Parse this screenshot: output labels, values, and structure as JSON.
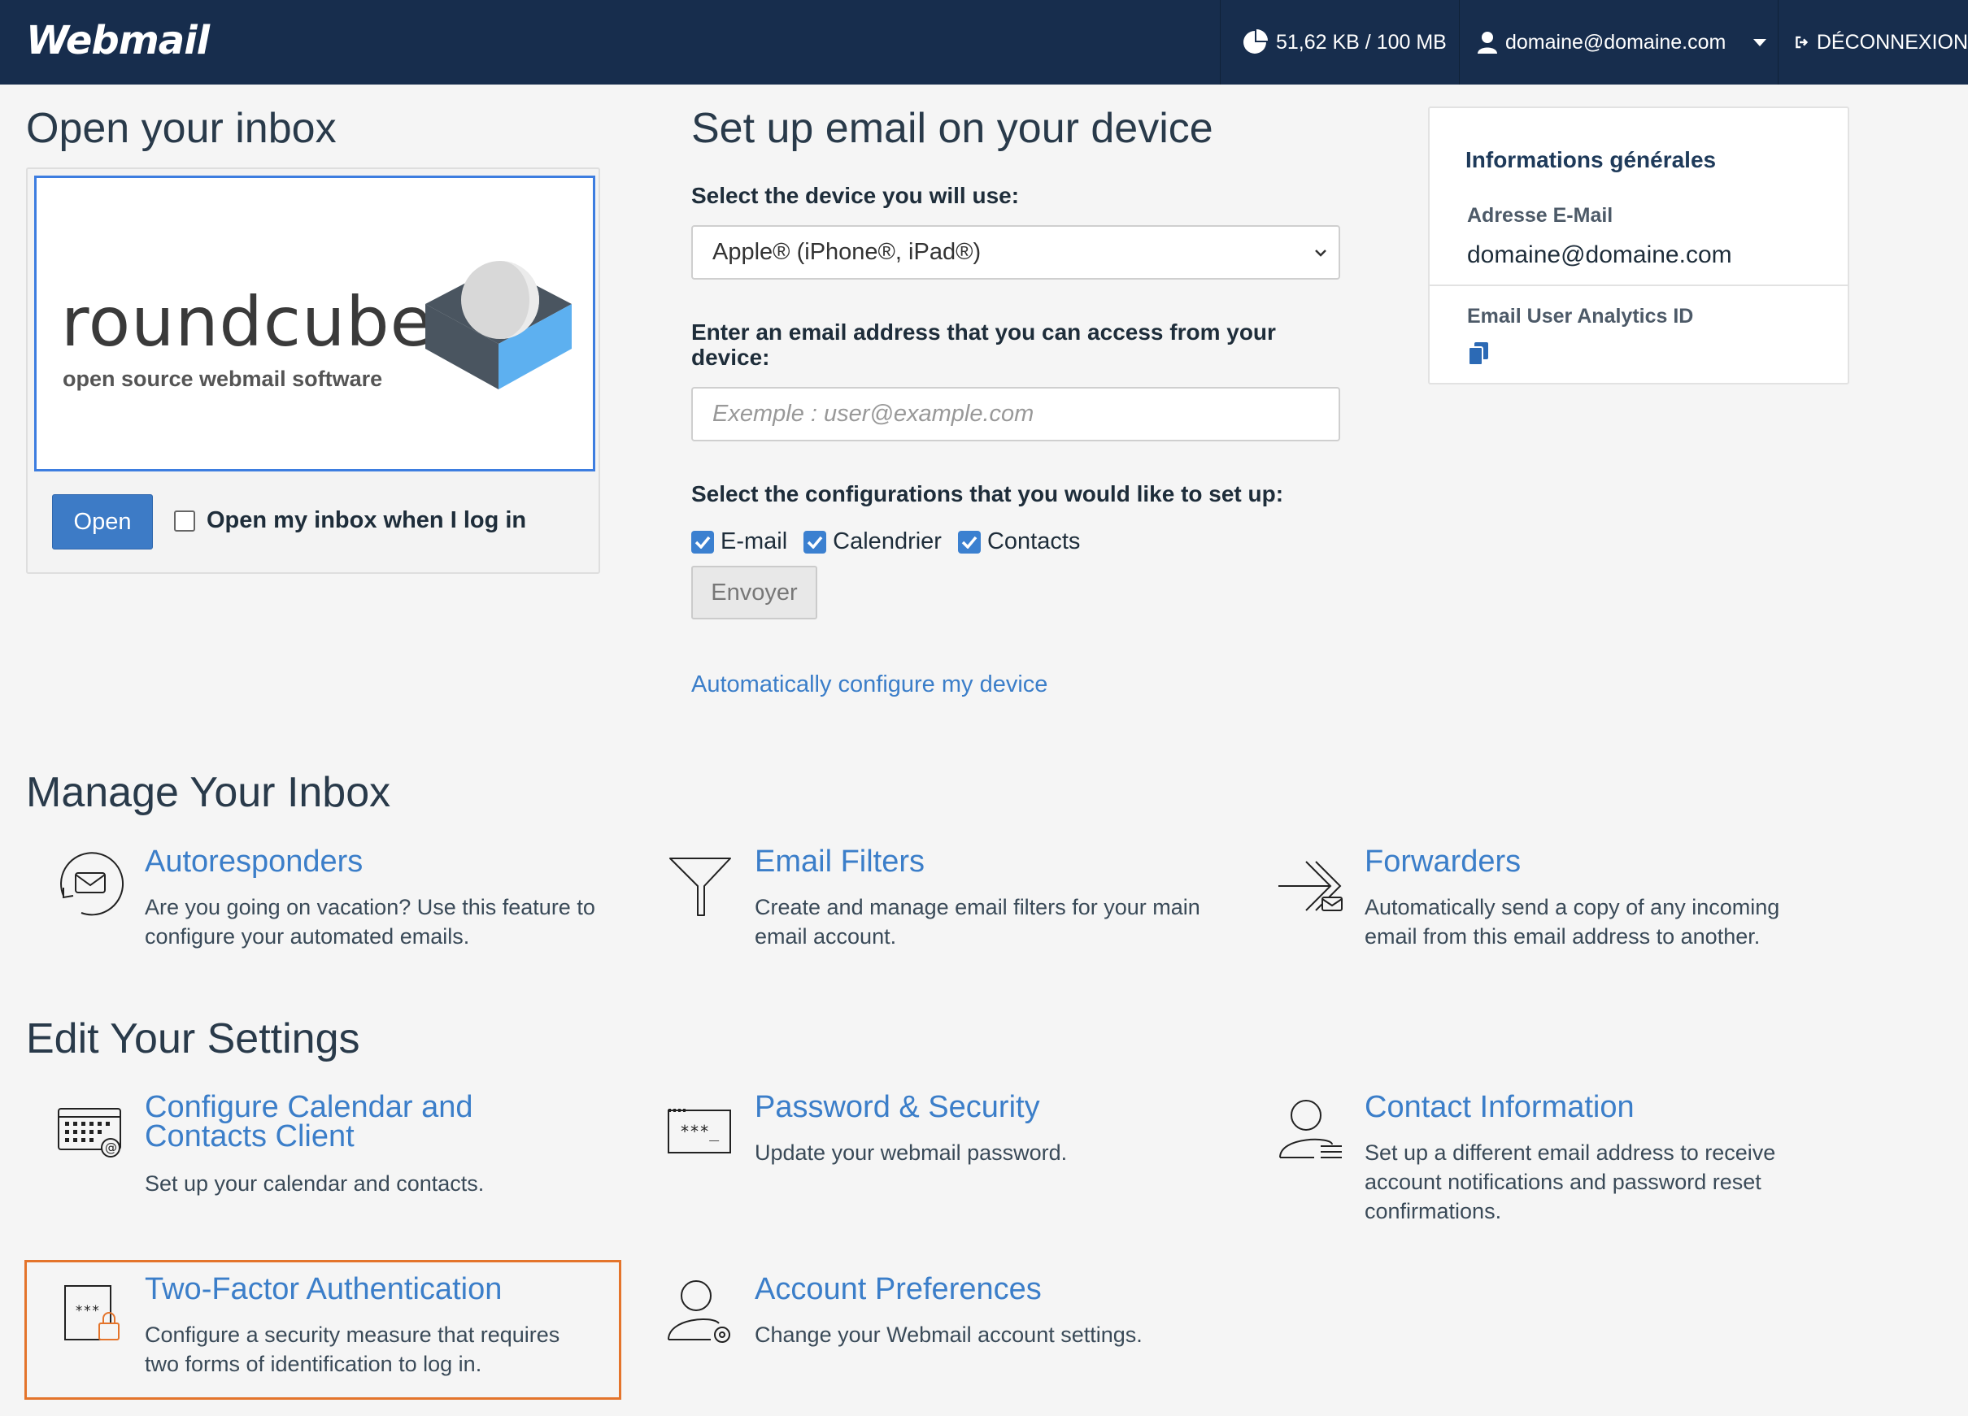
{
  "topbar": {
    "brand": "Webmail",
    "disk_usage": "51,62 KB / 100 MB",
    "user": "domaine@domaine.com",
    "logout": "DÉCONNEXION"
  },
  "inbox": {
    "heading": "Open your inbox",
    "logo_word": "roundcube",
    "logo_sub": "open source webmail software",
    "open_button": "Open",
    "open_on_login_label": "Open my inbox when I log in"
  },
  "device": {
    "heading": "Set up email on your device",
    "select_label": "Select the device you will use:",
    "select_value": "Apple® (iPhone®, iPad®)",
    "email_label": "Enter an email address that you can access from your device:",
    "email_placeholder": "Exemple : user@example.com",
    "config_label": "Select the configurations that you would like to set up:",
    "options": [
      "E-mail",
      "Calendrier",
      "Contacts"
    ],
    "send_button": "Envoyer",
    "auto_link": "Automatically configure my device"
  },
  "info": {
    "title": "Informations générales",
    "email_key": "Adresse E-Mail",
    "email_value": "domaine@domaine.com",
    "analytics_key": "Email User Analytics ID"
  },
  "manage": {
    "heading": "Manage Your Inbox",
    "items": [
      {
        "title": "Autoresponders",
        "desc_1": "Are you going on vacation? Use this feature to",
        "desc_2": "configure your automated emails."
      },
      {
        "title": "Email Filters",
        "desc_1": "Create and manage email filters for your main",
        "desc_2": "email account."
      },
      {
        "title": "Forwarders",
        "desc_1": "Automatically send a copy of any incoming",
        "desc_2": "email from this email address to another."
      }
    ]
  },
  "settings": {
    "heading": "Edit Your Settings",
    "calendar": {
      "title_1": "Configure Calendar and",
      "title_2": "Contacts Client",
      "desc_1": "Set up your calendar and contacts."
    },
    "password": {
      "title": "Password & Security",
      "desc_1": "Update your webmail password."
    },
    "contact": {
      "title": "Contact Information",
      "desc_1": "Set up a different email address to receive",
      "desc_2": "account notifications and password reset",
      "desc_3": "confirmations."
    },
    "twofa": {
      "title": "Two-Factor Authentication",
      "desc_1": "Configure a security measure that requires",
      "desc_2": "two forms of identification to log in."
    },
    "prefs": {
      "title": "Account Preferences",
      "desc_1": "Change your Webmail account settings."
    }
  },
  "colors": {
    "navbar": "#172d4d",
    "link": "#3b7ec9",
    "accent_highlight": "#e4742b",
    "primary_button": "#3d7bc6"
  }
}
